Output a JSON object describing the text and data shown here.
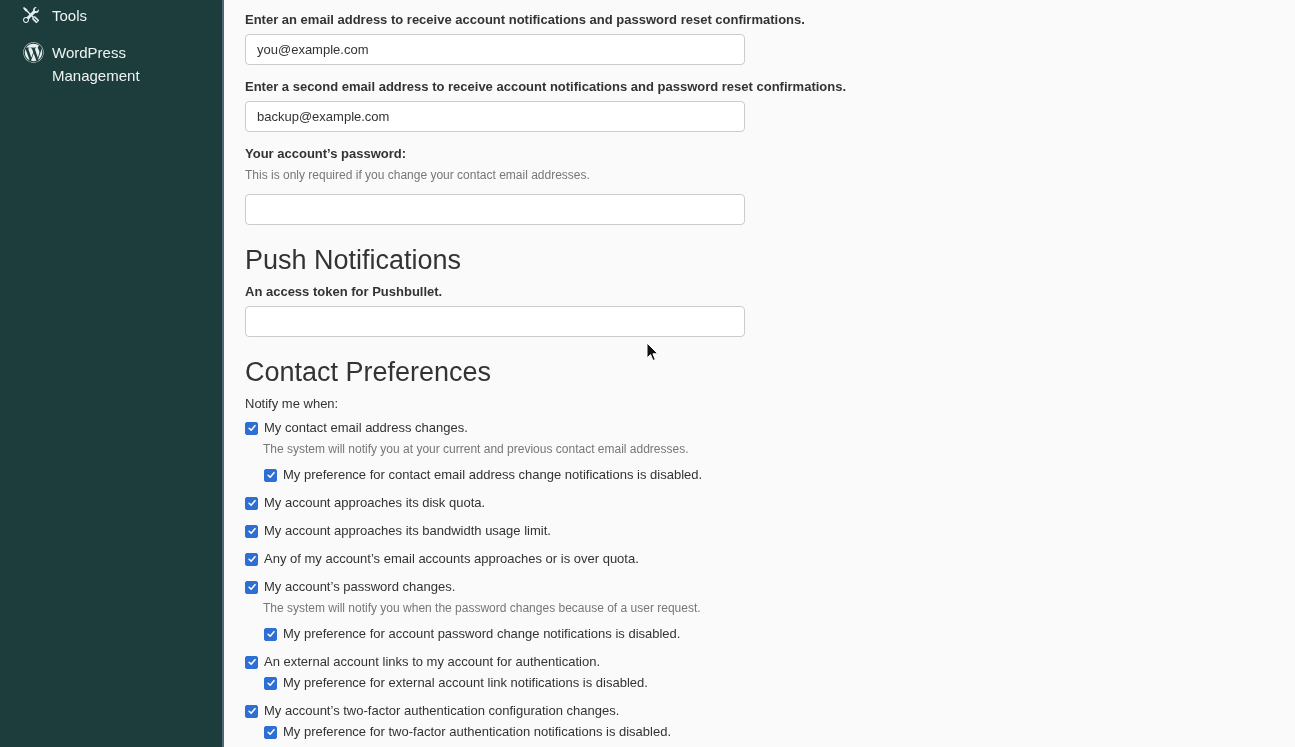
{
  "sidebar": {
    "items": [
      {
        "label": "Tools"
      },
      {
        "label": "WordPress Management"
      }
    ]
  },
  "contact_information": {
    "fields": [
      {
        "label": "Enter an email address to receive account notifications and password reset confirmations.",
        "value": "you@example.com"
      },
      {
        "label": "Enter a second email address to receive account notifications and password reset confirmations.",
        "value": "backup@example.com"
      },
      {
        "label": "Your account’s password:",
        "help": "This is only required if you change your contact email addresses."
      }
    ]
  },
  "push_notifications": {
    "title": "Push Notifications",
    "fields": [
      {
        "label": "An access token for Pushbullet."
      }
    ]
  },
  "contact_preferences": {
    "title": "Contact Preferences",
    "intro": "Notify me when:",
    "options": [
      {
        "label": "My contact email address changes.",
        "checked": true,
        "help": "The system will notify you at your current and previous contact email addresses.",
        "children": [
          {
            "label": "My preference for contact email address change notifications is disabled.",
            "checked": true
          }
        ]
      },
      {
        "label": "My account approaches its disk quota.",
        "checked": true
      },
      {
        "label": "My account approaches its bandwidth usage limit.",
        "checked": true
      },
      {
        "label": "Any of my account’s email accounts approaches or is over quota.",
        "checked": true
      },
      {
        "label": "My account’s password changes.",
        "checked": true,
        "help": "The system will notify you when the password changes because of a user request.",
        "children": [
          {
            "label": "My preference for account password change notifications is disabled.",
            "checked": true
          }
        ]
      },
      {
        "label": "An external account links to my account for authentication.",
        "checked": true,
        "children": [
          {
            "label": "My preference for external account link notifications is disabled.",
            "checked": true
          }
        ]
      },
      {
        "label": "My account’s two-factor authentication configuration changes.",
        "checked": true,
        "children": [
          {
            "label": "My preference for two-factor authentication notifications is disabled.",
            "checked": true
          }
        ]
      }
    ]
  }
}
